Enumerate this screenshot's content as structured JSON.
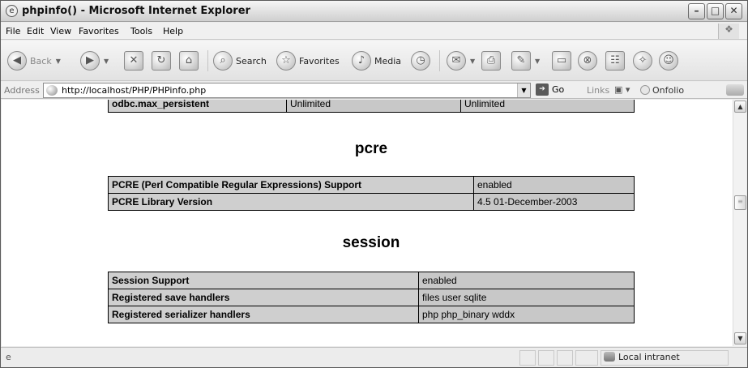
{
  "window": {
    "title": "phpinfo() - Microsoft Internet Explorer",
    "minimize_glyph": "–",
    "maximize_glyph": "□",
    "close_glyph": "✕"
  },
  "menu": [
    "File",
    "Edit",
    "View",
    "Favorites",
    "Tools",
    "Help"
  ],
  "toolbar": {
    "back": "Back",
    "search": "Search",
    "favorites": "Favorites",
    "media": "Media"
  },
  "address": {
    "label": "Address",
    "url": "http://localhost/PHP/PHPinfo.php",
    "go": "Go",
    "links": "Links",
    "onfolio": "Onfolio"
  },
  "odbc_row": {
    "directive": "odbc.max_persistent",
    "local": "Unlimited",
    "master": "Unlimited"
  },
  "sections": [
    {
      "title": "pcre",
      "rows": [
        {
          "name": "PCRE (Perl Compatible Regular Expressions) Support",
          "value": "enabled"
        },
        {
          "name": "PCRE Library Version",
          "value": "4.5 01-December-2003"
        }
      ]
    },
    {
      "title": "session",
      "rows": [
        {
          "name": "Session Support",
          "value": "enabled"
        },
        {
          "name": "Registered save handlers",
          "value": "files user sqlite"
        },
        {
          "name": "Registered serializer handlers",
          "value": "php php_binary wddx"
        }
      ]
    }
  ],
  "status": {
    "zone": "Local intranet"
  }
}
